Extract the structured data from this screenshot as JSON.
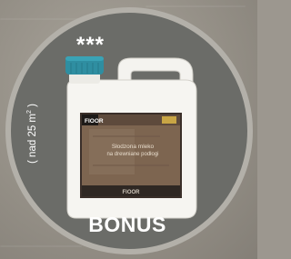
{
  "rating_stars": "***",
  "area_note": {
    "prefix": "( nad 25 m",
    "superscript": "2",
    "suffix": " )"
  },
  "bonus_label": "BONUS",
  "product": {
    "brand": "FIOOR",
    "title_line1": "Słodzona mleko",
    "title_line2": "na drewniane podłogi",
    "footer_brand": "FIOOR"
  },
  "colors": {
    "badge": "#6b6c68",
    "badge_border": "#b3b0a9",
    "cap": "#2f8ea1",
    "label_wood": "#7d6550",
    "label_dark": "#3a2f29",
    "text": "#ffffff"
  }
}
